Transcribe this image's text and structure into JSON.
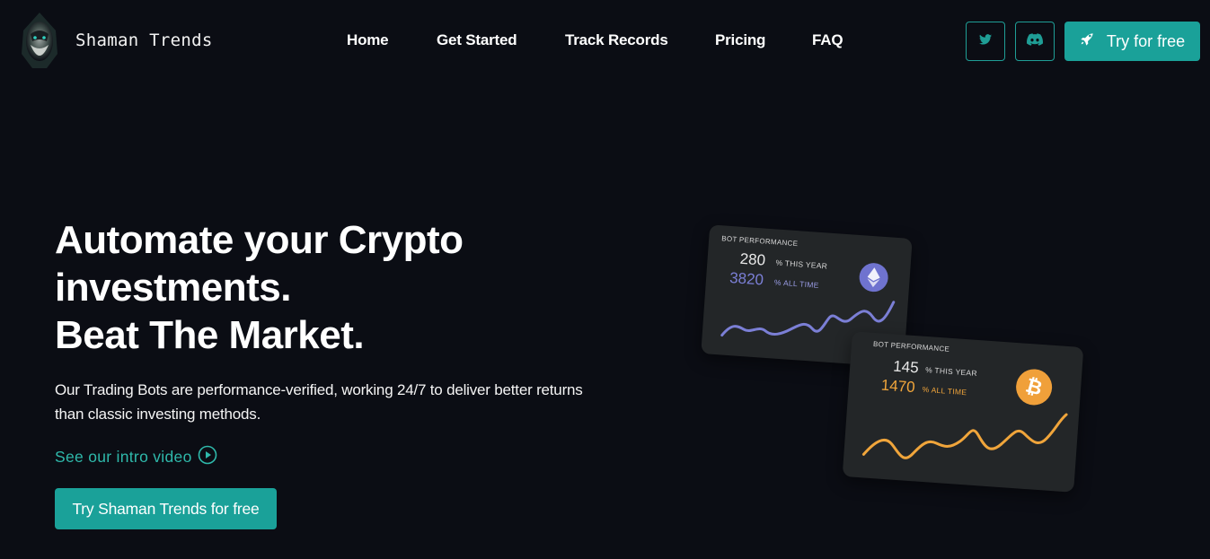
{
  "brand": {
    "name": "Shaman Trends",
    "logo_icon": "shaman-logo-icon"
  },
  "nav": {
    "items": [
      {
        "label": "Home"
      },
      {
        "label": "Get Started"
      },
      {
        "label": "Track Records"
      },
      {
        "label": "Pricing"
      },
      {
        "label": "FAQ"
      }
    ]
  },
  "header_actions": {
    "twitter_icon": "twitter-icon",
    "discord_icon": "discord-icon",
    "try_label": "Try for free",
    "try_icon": "rocket-icon",
    "accent_color": "#1aa199"
  },
  "hero": {
    "title_line1": "Automate your Crypto",
    "title_line2": "investments.",
    "title_line3": "Beat The Market.",
    "description": "Our Trading Bots are performance-verified, working 24/7 to deliver better returns than classic investing methods.",
    "intro_link": "See our intro video",
    "intro_icon": "play-circle-icon",
    "cta_label": "Try Shaman Trends for free"
  },
  "cards": [
    {
      "label": "BOT PERFORMANCE",
      "year_value": "280",
      "year_unit": "% THIS YEAR",
      "all_value": "3820",
      "all_unit": "% ALL TIME",
      "coin_icon": "ethereum-icon",
      "color": "#7b7fd6"
    },
    {
      "label": "BOT PERFORMANCE",
      "year_value": "145",
      "year_unit": "% THIS YEAR",
      "all_value": "1470",
      "all_unit": "% ALL TIME",
      "coin_icon": "bitcoin-icon",
      "color": "#f0a53b"
    }
  ]
}
